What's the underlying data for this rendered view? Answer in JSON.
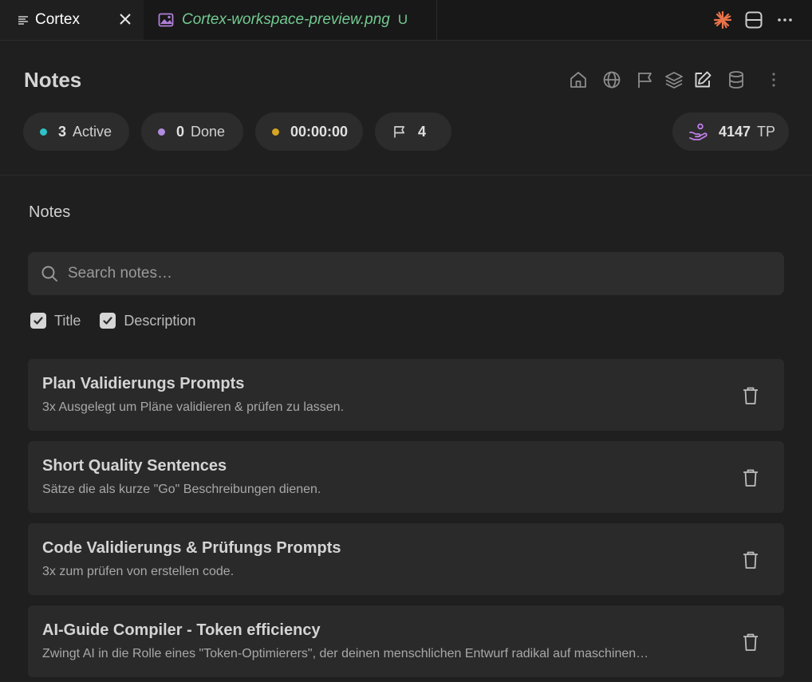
{
  "tabs": [
    {
      "title": "Cortex",
      "icon": "menu-lines-icon",
      "active": true
    },
    {
      "title": "Cortex-workspace-preview.png",
      "icon": "image-file-icon",
      "badge": "U"
    }
  ],
  "header": {
    "title": "Notes",
    "icons": [
      "home-icon",
      "globe-icon",
      "flag-icon",
      "layers-icon",
      "edit-icon",
      "database-icon",
      "more-vertical-icon"
    ]
  },
  "stats": {
    "active": {
      "count": "3",
      "label": "Active",
      "color": "#2ec4c9"
    },
    "done": {
      "count": "0",
      "label": "Done",
      "color": "#b18be0"
    },
    "timer": {
      "value": "00:00:00",
      "color": "#d7a520"
    },
    "flags": {
      "count": "4"
    },
    "tp": {
      "value": "4147",
      "unit": "TP",
      "icon": "hand-coins-icon",
      "color": "#c07ee8"
    }
  },
  "notes_section": {
    "title": "Notes",
    "search_placeholder": "Search notes…",
    "filters": [
      {
        "label": "Title",
        "checked": true
      },
      {
        "label": "Description",
        "checked": true
      }
    ],
    "items": [
      {
        "title": "Plan Validierungs Prompts",
        "description": "3x Ausgelegt um Pläne validieren & prüfen zu lassen."
      },
      {
        "title": "Short Quality Sentences",
        "description": "Sätze die als kurze \"Go\" Beschreibungen dienen."
      },
      {
        "title": "Code Validierungs & Prüfungs Prompts",
        "description": "3x zum prüfen von erstellen code."
      },
      {
        "title": "AI-Guide Compiler - Token efficiency",
        "description": "Zwingt AI in die Rolle eines \"Token-Optimierers\", der deinen menschlichen Entwurf radikal auf maschinen…"
      }
    ]
  },
  "colors": {
    "accent_green": "#73c991",
    "sparkle": "#e8734a"
  }
}
